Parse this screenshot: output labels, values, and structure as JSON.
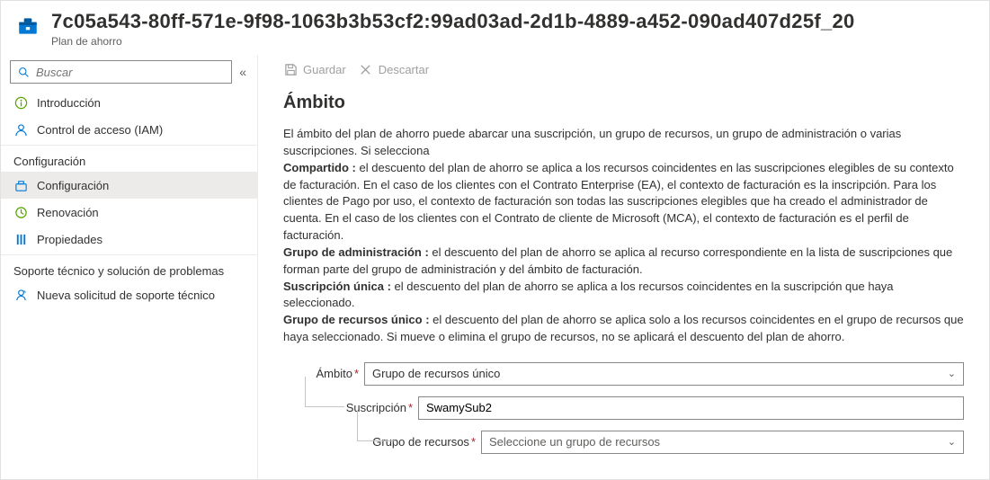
{
  "header": {
    "title": "7c05a543-80ff-571e-9f98-1063b3b53cf2:99ad03ad-2d1b-4889-a452-090ad407d25f_20",
    "subtitle": "Plan de ahorro"
  },
  "sidebar": {
    "search_placeholder": "Buscar",
    "items_top": [
      {
        "label": "Introducción"
      },
      {
        "label": "Control de acceso (IAM)"
      }
    ],
    "section_config": "Configuración",
    "items_config": [
      {
        "label": "Configuración"
      },
      {
        "label": "Renovación"
      },
      {
        "label": "Propiedades"
      }
    ],
    "section_support": "Soporte técnico y solución de problemas",
    "items_support": [
      {
        "label": "Nueva solicitud de soporte técnico"
      }
    ]
  },
  "commands": {
    "save": "Guardar",
    "discard": "Descartar"
  },
  "main": {
    "heading": "Ámbito",
    "intro": "El ámbito del plan de ahorro puede abarcar una suscripción, un grupo de recursos, un grupo de administración o varias suscripciones. Si selecciona",
    "shared_label": "Compartido :",
    "shared_text": " el descuento del plan de ahorro se aplica a los recursos coincidentes en las suscripciones elegibles de su contexto de facturación. En el caso de los clientes con el Contrato Enterprise (EA), el contexto de facturación es la inscripción. Para los clientes de Pago por uso, el contexto de facturación son todas las suscripciones elegibles que ha creado el administrador de cuenta. En el caso de los clientes con el Contrato de cliente de Microsoft (MCA), el contexto de facturación es el perfil de facturación.",
    "mg_label": "Grupo de administración :",
    "mg_text": "  el descuento del plan de ahorro se aplica al recurso correspondiente en la lista de suscripciones que forman parte del grupo de administración y del ámbito de facturación.",
    "single_sub_label": "Suscripción única :",
    "single_sub_text": " el descuento del plan de ahorro se aplica a los recursos coincidentes en la suscripción que haya seleccionado.",
    "single_rg_label": "Grupo de recursos único :",
    "single_rg_text": " el descuento del plan de ahorro se aplica solo a los recursos coincidentes en el grupo de recursos que haya seleccionado. Si mueve o elimina el grupo de recursos, no se aplicará el descuento del plan de ahorro."
  },
  "form": {
    "scope_label": "Ámbito",
    "scope_value": "Grupo de recursos único",
    "subscription_label": "Suscripción",
    "subscription_value": "SwamySub2",
    "rg_label": "Grupo de recursos",
    "rg_placeholder": "Seleccione un grupo de recursos"
  }
}
